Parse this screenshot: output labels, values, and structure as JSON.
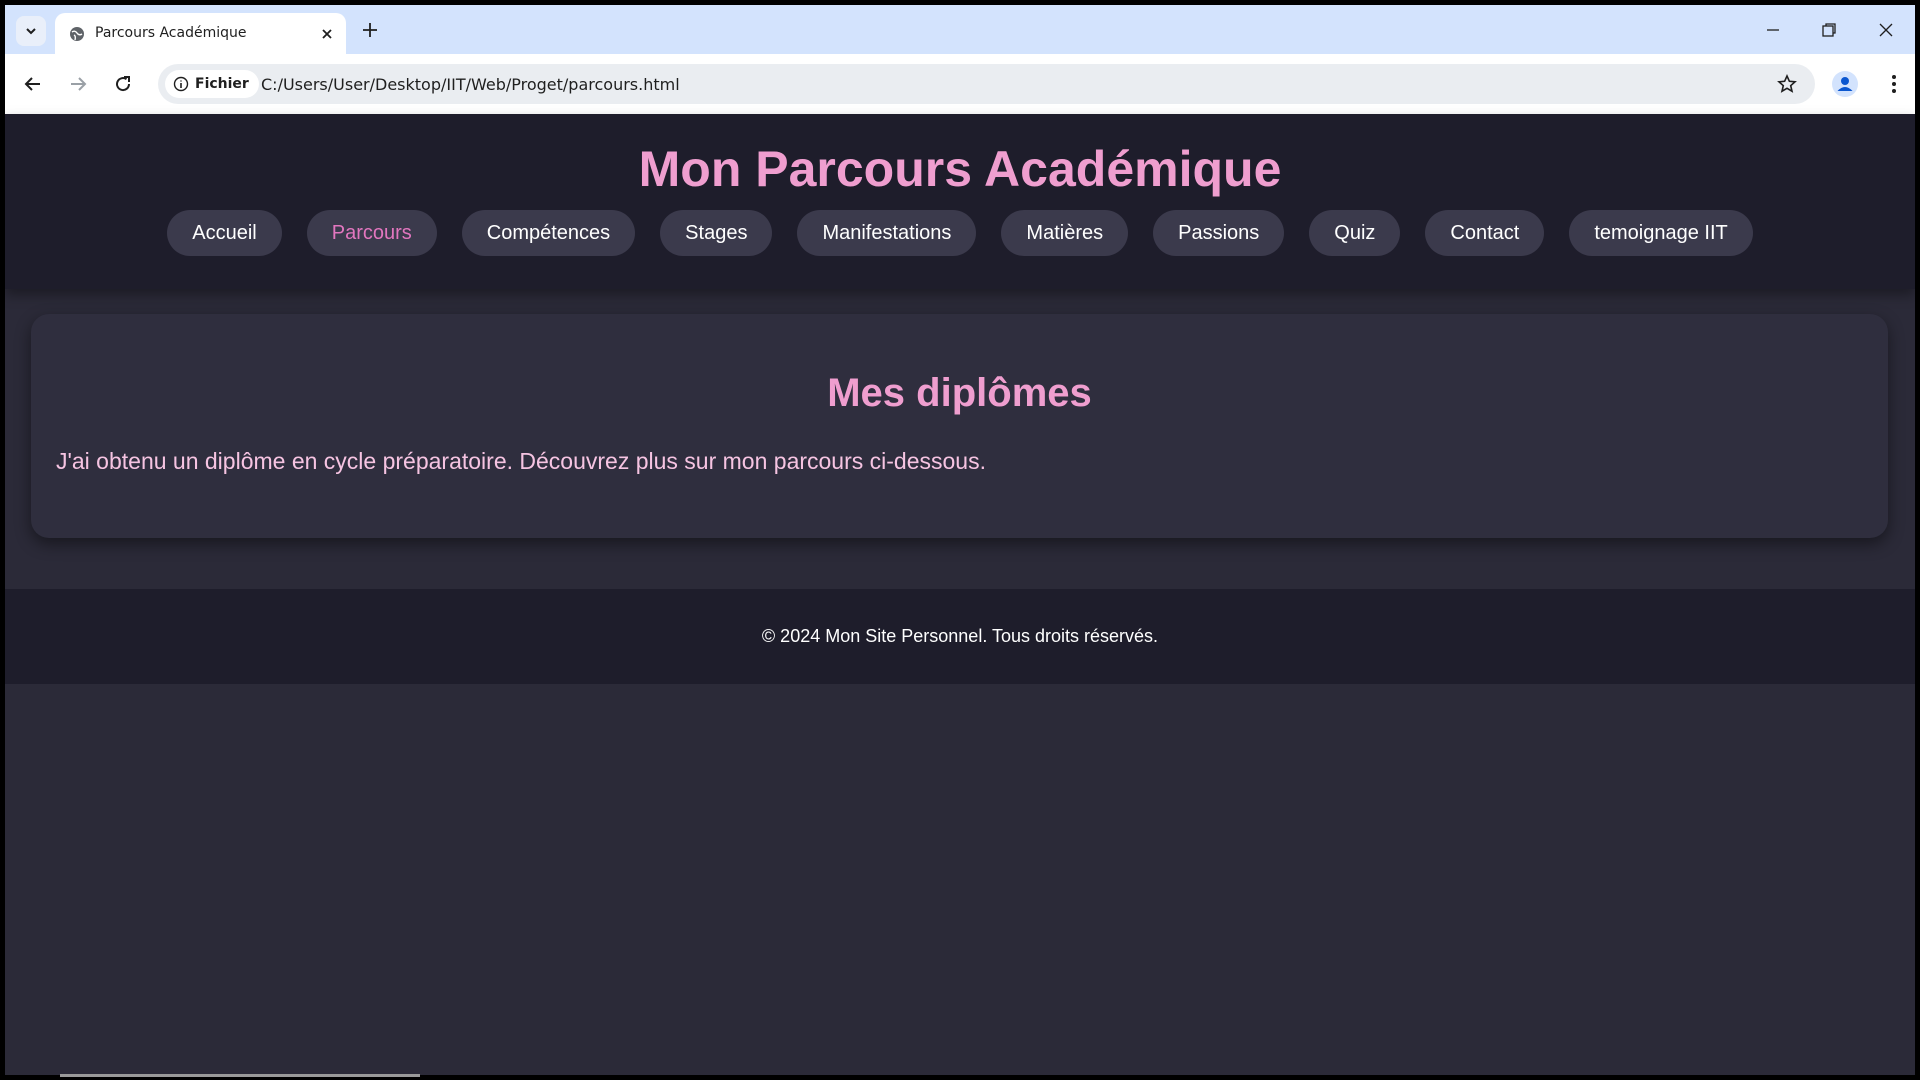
{
  "browser": {
    "tab_title": "Parcours Académique",
    "security_chip": "Fichier",
    "url": "C:/Users/User/Desktop/IIT/Web/Proget/parcours.html",
    "accent_color": "#d3e3fd"
  },
  "site": {
    "title": "Mon Parcours Académique",
    "nav": [
      {
        "label": "Accueil",
        "active": false
      },
      {
        "label": "Parcours",
        "active": true
      },
      {
        "label": "Compétences",
        "active": false
      },
      {
        "label": "Stages",
        "active": false
      },
      {
        "label": "Manifestations",
        "active": false
      },
      {
        "label": "Matières",
        "active": false
      },
      {
        "label": "Passions",
        "active": false
      },
      {
        "label": "Quiz",
        "active": false
      },
      {
        "label": "Contact",
        "active": false
      },
      {
        "label": "temoignage IIT",
        "active": false
      }
    ],
    "section_title": "Mes diplômes",
    "section_text": "J'ai obtenu un diplôme en cycle préparatoire. Découvrez plus sur mon parcours ci-dessous.",
    "footer": "© 2024 Mon Site Personnel. Tous droits réservés.",
    "colors": {
      "title_pink": "#ef9ecf",
      "active_nav_pink": "#e276bf",
      "header_bg": "#1e1d2b",
      "page_bg": "#2b2a38"
    }
  }
}
